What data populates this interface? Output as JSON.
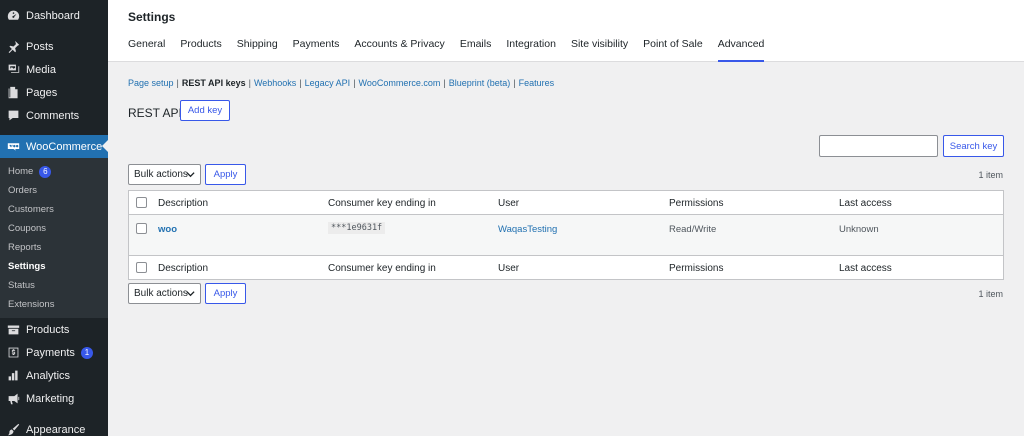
{
  "sidebar": {
    "items": [
      {
        "label": "Dashboard",
        "icon": "dashboard-icon"
      },
      {
        "label": "Posts",
        "icon": "pin-icon"
      },
      {
        "label": "Media",
        "icon": "media-icon"
      },
      {
        "label": "Pages",
        "icon": "pages-icon"
      },
      {
        "label": "Comments",
        "icon": "comments-icon"
      },
      {
        "label": "WooCommerce",
        "icon": "woocommerce-icon"
      },
      {
        "label": "Products",
        "icon": "archive-icon"
      },
      {
        "label": "Payments",
        "icon": "payments-icon",
        "badge": "1"
      },
      {
        "label": "Analytics",
        "icon": "chart-icon"
      },
      {
        "label": "Marketing",
        "icon": "megaphone-icon"
      },
      {
        "label": "Appearance",
        "icon": "brush-icon"
      }
    ],
    "woo_submenu": [
      {
        "label": "Home",
        "badge": "6"
      },
      {
        "label": "Orders"
      },
      {
        "label": "Customers"
      },
      {
        "label": "Coupons"
      },
      {
        "label": "Reports"
      },
      {
        "label": "Settings"
      },
      {
        "label": "Status"
      },
      {
        "label": "Extensions"
      }
    ]
  },
  "header": {
    "title": "Settings",
    "tabs": [
      "General",
      "Products",
      "Shipping",
      "Payments",
      "Accounts & Privacy",
      "Emails",
      "Integration",
      "Site visibility",
      "Point of Sale",
      "Advanced"
    ]
  },
  "subnav": {
    "items": [
      "Page setup",
      "REST API keys",
      "Webhooks",
      "Legacy API",
      "WooCommerce.com",
      "Blueprint (beta)",
      "Features"
    ],
    "separator": "|"
  },
  "rest": {
    "title": "REST API",
    "add_key": "Add key",
    "search_button": "Search key",
    "bulk_actions": "Bulk actions",
    "apply": "Apply",
    "count": "1 item"
  },
  "table": {
    "columns": [
      "Description",
      "Consumer key ending in",
      "User",
      "Permissions",
      "Last access"
    ],
    "rows": [
      {
        "description": "woo",
        "key": "***1e9631f",
        "user": "WaqasTesting",
        "permissions": "Read/Write",
        "last_access": "Unknown"
      }
    ]
  },
  "colors": {
    "sidebar_bg": "#1d2327",
    "accent": "#2271b1",
    "button_blue": "#3858e9"
  }
}
